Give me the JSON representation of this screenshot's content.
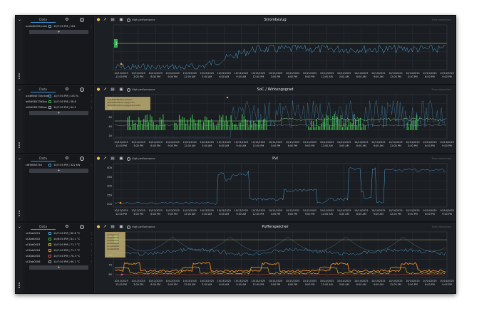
{
  "colors": {
    "background": "#1c1f23",
    "grid": "#343940",
    "accent_blue": "#4f9fcf",
    "green": "#3fb94c",
    "orange": "#e98b2a",
    "threshold": "#6fae3a"
  },
  "sidebar_common": {
    "data_tab": "Data",
    "add_label": "+"
  },
  "time_ticks": [
    "10/12/2025\n12:00 PM",
    "10/12/2025\n3:00 PM",
    "10/12/2025\n6:00 PM",
    "10/12/2025\n9:00 PM",
    "10/13/2025\n12:00 AM",
    "10/13/2025\n3:00 AM",
    "10/13/2025\n6:00 AM",
    "10/13/2025\n9:00 AM",
    "10/13/2025\n12:00 PM",
    "10/13/2025\n3:00 PM",
    "10/13/2025\n6:00 PM",
    "10/13/2025\n9:00 PM",
    "10/14/2025\n12:00 AM",
    "10/14/2025\n3:00 AM",
    "10/14/2025\n6:00 AM",
    "10/14/2025\n9:00 AM",
    "10/14/2025\n12:00 PM",
    "10/14/2025\n3:00 PM",
    "10/14/2025\n6:00 PM",
    "10/14/2025\n9:00 PM"
  ],
  "toolbar": {
    "high_performance": "High performance"
  },
  "panels": [
    {
      "title": "Strombezug",
      "right_label": "Time interaction",
      "rows": [
        {
          "name": "ucdb40005uuids",
          "value": "10/7:00 PM | 182",
          "color": "#4f9fcf"
        }
      ],
      "badge": "AW",
      "y_ticks": []
    },
    {
      "title": "SoC / Wirkungsgrad",
      "right_label": "Time interaction",
      "rows": [
        {
          "name": "uxt8f840730c5de",
          "value": "10/7:00 PM | 100 %",
          "color": "#4f9fcf"
        },
        {
          "name": "e6f4f08073b5ba",
          "value": "10/7:00 PM | 38.6",
          "color": "#3fb94c"
        },
        {
          "name": "e6f4f0807360aa",
          "value": "10/7:00 PM | 64.2",
          "color": "#9aa0a6"
        }
      ],
      "legend": [
        "e6f4f0807Batteriedaten",
        "e6f4f0807Wirkungsgrad%",
        "e6f4f0807Wirkungsgrad/Anzahl"
      ],
      "y_ticks": [
        "100",
        "80",
        "60",
        "40",
        "20"
      ]
    },
    {
      "title": "PvI",
      "right_label": "Time interaction",
      "rows": [
        {
          "name": "c6f4f08073d",
          "value": "10/7:00 PM | 322 kW",
          "color": "#4f9fcf"
        }
      ],
      "y_ticks": [
        "400",
        "350",
        "300",
        "250",
        "200"
      ]
    },
    {
      "title": "Pufferspeicher",
      "right_label": "Time interaction",
      "rows": [
        {
          "name": "sC4bb0001",
          "value": "10/7:00 PM | 80.6 °C",
          "color": "#4f9fcf"
        },
        {
          "name": "sC4bb0002",
          "value": "10/8:00 PM | 81.1 °C",
          "color": "#3fb94c"
        },
        {
          "name": "sC4bb0003",
          "value": "10/7:00 PM | 71.7 °C",
          "color": "#e9c52a"
        },
        {
          "name": "sC4bb0004",
          "value": "10/7:00 PM | 71.7 °C",
          "color": "#e98b2a"
        },
        {
          "name": "sC4bb0005",
          "value": "10/7:00 PM | 70.3 °C",
          "color": "#e0533a"
        },
        {
          "name": "sC4bb0006",
          "value": "10/7:00 PM | 60.1 °C",
          "color": "#9aa0a6"
        }
      ],
      "legend": [
        "sC4bb0001",
        "sC4bb0002",
        "sC4bb0003",
        "sC4bb0004",
        "sC4bb0005",
        "sC4bb0006"
      ],
      "badge": "AW",
      "y_ticks": [
        "85",
        "80",
        "75",
        "70",
        "65"
      ]
    }
  ]
}
